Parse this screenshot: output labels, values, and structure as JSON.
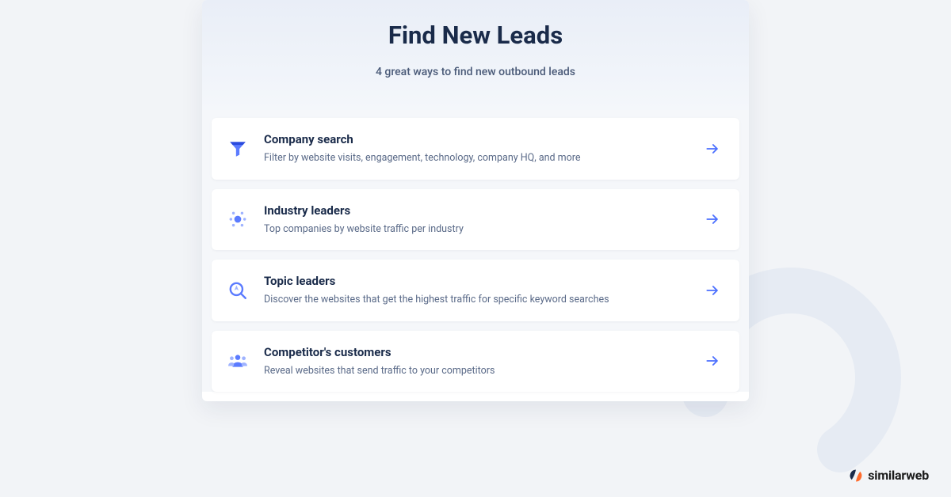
{
  "header": {
    "title": "Find New Leads",
    "subtitle": "4 great ways to find new outbound leads"
  },
  "cards": [
    {
      "title": "Company search",
      "desc": "Filter by website visits, engagement, technology, company HQ, and more"
    },
    {
      "title": "Industry leaders",
      "desc": "Top companies by website traffic per industry"
    },
    {
      "title": "Topic leaders",
      "desc": "Discover the websites that get the highest traffic for specific keyword searches"
    },
    {
      "title": "Competitor's customers",
      "desc": "Reveal websites that send traffic to your competitors"
    }
  ],
  "brand": {
    "name": "similarweb"
  },
  "colors": {
    "accent": "#4b6fff"
  }
}
